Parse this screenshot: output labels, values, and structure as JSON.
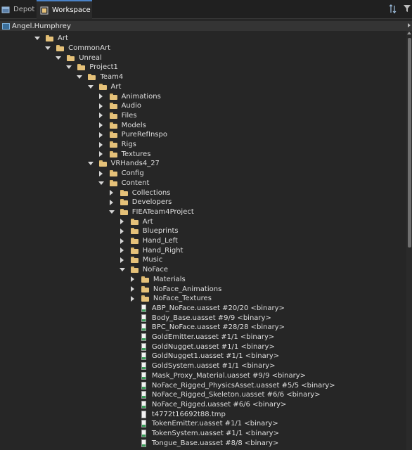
{
  "tabs": [
    {
      "label": "Depot",
      "icon": "depot-icon",
      "active": false
    },
    {
      "label": "Workspace",
      "icon": "workspace-icon",
      "active": true
    }
  ],
  "toolbar": {
    "sort_icon": "sort-icon",
    "filter_icon": "filter-icon"
  },
  "workspace": {
    "name": "Angel.Humphrey",
    "icon": "workspace-root-icon"
  },
  "tree": [
    {
      "depth": 0,
      "type": "folder",
      "expanded": true,
      "label": "Art"
    },
    {
      "depth": 1,
      "type": "folder",
      "expanded": true,
      "label": "CommonArt"
    },
    {
      "depth": 2,
      "type": "folder",
      "expanded": true,
      "label": "Unreal"
    },
    {
      "depth": 3,
      "type": "folder",
      "expanded": true,
      "label": "Project1"
    },
    {
      "depth": 4,
      "type": "folder",
      "expanded": true,
      "label": "Team4"
    },
    {
      "depth": 5,
      "type": "folder",
      "expanded": true,
      "label": "Art"
    },
    {
      "depth": 6,
      "type": "folder",
      "expanded": false,
      "label": "Animations"
    },
    {
      "depth": 6,
      "type": "folder",
      "expanded": false,
      "label": "Audio"
    },
    {
      "depth": 6,
      "type": "folder",
      "expanded": false,
      "label": "Files"
    },
    {
      "depth": 6,
      "type": "folder",
      "expanded": false,
      "label": "Models"
    },
    {
      "depth": 6,
      "type": "folder",
      "expanded": false,
      "label": "PureRefInspo"
    },
    {
      "depth": 6,
      "type": "folder",
      "expanded": false,
      "label": "Rigs"
    },
    {
      "depth": 6,
      "type": "folder",
      "expanded": false,
      "label": "Textures"
    },
    {
      "depth": 5,
      "type": "folder",
      "expanded": true,
      "label": "VRHands4_27"
    },
    {
      "depth": 6,
      "type": "folder",
      "expanded": false,
      "label": "Config"
    },
    {
      "depth": 6,
      "type": "folder",
      "expanded": true,
      "label": "Content"
    },
    {
      "depth": 7,
      "type": "folder",
      "expanded": false,
      "label": "Collections"
    },
    {
      "depth": 7,
      "type": "folder",
      "expanded": false,
      "label": "Developers"
    },
    {
      "depth": 7,
      "type": "folder",
      "expanded": true,
      "label": "FIEATeam4Project"
    },
    {
      "depth": 8,
      "type": "folder",
      "expanded": false,
      "label": "Art"
    },
    {
      "depth": 8,
      "type": "folder",
      "expanded": false,
      "label": "Blueprints"
    },
    {
      "depth": 8,
      "type": "folder",
      "expanded": false,
      "label": "Hand_Left"
    },
    {
      "depth": 8,
      "type": "folder",
      "expanded": false,
      "label": "Hand_Right"
    },
    {
      "depth": 8,
      "type": "folder",
      "expanded": false,
      "label": "Music"
    },
    {
      "depth": 8,
      "type": "folder",
      "expanded": true,
      "label": "NoFace"
    },
    {
      "depth": 9,
      "type": "folder",
      "expanded": false,
      "label": "Materials"
    },
    {
      "depth": 9,
      "type": "folder",
      "expanded": false,
      "label": "NoFace_Animations"
    },
    {
      "depth": 9,
      "type": "folder",
      "expanded": false,
      "label": "NoFace_Textures"
    },
    {
      "depth": 9,
      "type": "file",
      "binary": true,
      "label": "ABP_NoFace.uasset #20/20 <binary>"
    },
    {
      "depth": 9,
      "type": "file",
      "binary": true,
      "label": "Body_Base.uasset #9/9 <binary>"
    },
    {
      "depth": 9,
      "type": "file",
      "binary": true,
      "label": "BPC_NoFace.uasset #28/28 <binary>"
    },
    {
      "depth": 9,
      "type": "file",
      "binary": true,
      "label": "GoldEmitter.uasset #1/1 <binary>"
    },
    {
      "depth": 9,
      "type": "file",
      "binary": true,
      "label": "GoldNugget.uasset #1/1 <binary>"
    },
    {
      "depth": 9,
      "type": "file",
      "binary": true,
      "label": "GoldNugget1.uasset #1/1 <binary>"
    },
    {
      "depth": 9,
      "type": "file",
      "binary": true,
      "label": "GoldSystem.uasset #1/1 <binary>"
    },
    {
      "depth": 9,
      "type": "file",
      "binary": true,
      "label": "Mask_Proxy_Material.uasset #9/9 <binary>"
    },
    {
      "depth": 9,
      "type": "file",
      "binary": true,
      "label": "NoFace_Rigged_PhysicsAsset.uasset #5/5 <binary>"
    },
    {
      "depth": 9,
      "type": "file",
      "binary": true,
      "label": "NoFace_Rigged_Skeleton.uasset #6/6 <binary>"
    },
    {
      "depth": 9,
      "type": "file",
      "binary": true,
      "label": "NoFace_Rigged.uasset #6/6 <binary>"
    },
    {
      "depth": 9,
      "type": "file",
      "binary": false,
      "label": "t4772t16692t88.tmp"
    },
    {
      "depth": 9,
      "type": "file",
      "binary": true,
      "label": "TokenEmitter.uasset #1/1 <binary>"
    },
    {
      "depth": 9,
      "type": "file",
      "binary": true,
      "label": "TokenSystem.uasset #1/1 <binary>"
    },
    {
      "depth": 9,
      "type": "file",
      "binary": true,
      "label": "Tongue_Base.uasset #8/8 <binary>"
    }
  ]
}
